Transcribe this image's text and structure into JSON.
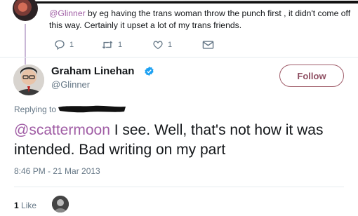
{
  "parent_tweet": {
    "mention": "@Glinner",
    "text": " by eg having the trans woman throw the punch first , it didn't come off this way. Certainly it upset a lot of my trans friends.",
    "reply_count": "1",
    "retweet_count": "1",
    "like_count": "1"
  },
  "main_tweet": {
    "author_name": "Graham Linehan",
    "author_handle": "@Glinner",
    "follow_label": "Follow",
    "replying_to_label": "Replying to",
    "mention": "@scattermoon",
    "text": " I see. Well, that's not how it was intended. Bad writing on my part",
    "timestamp": "8:46 PM - 21 Mar 2013",
    "like_count": "1",
    "like_label": "Like"
  },
  "colors": {
    "accent": "#a05da5",
    "follow_border": "#a05d6a",
    "secondary_text": "#657786",
    "verified": "#1da1f2"
  },
  "icons": [
    "reply-icon",
    "retweet-icon",
    "heart-icon",
    "message-icon",
    "verified-badge-icon"
  ]
}
